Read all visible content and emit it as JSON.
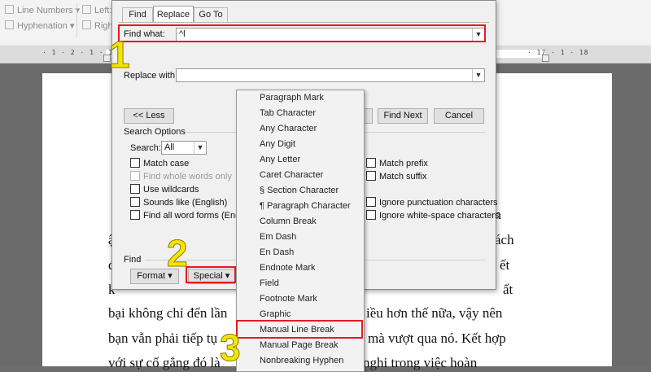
{
  "ribbon": {
    "line_numbers": "Line Numbers",
    "hyphenation": "Hyphenation",
    "left_label": "Left:",
    "right_label": "Righ"
  },
  "ruler": {
    "left_marks": "· 1 · 2 · 1 · 1 · 1 · 2",
    "right_marks": "· 17 · 1 · 18"
  },
  "document": {
    "lines_right": [
      "n",
      "h",
      "ăn",
      "ách",
      "ết",
      "ất"
    ],
    "line_left_1": "ậ",
    "line_left_2": "đ",
    "line_left_3": "k",
    "line_a_left": "bại không chỉ đến lần",
    "line_a_right": "iều hơn thế nữa, vậy nên",
    "line_b_left": "bạn vẫn phải tiếp tụ",
    "line_b_right": "mà vượt qua nó. Kết hợp",
    "line_c_left": "với sự cố gắng đó là",
    "line_c_right": "nghi trong việc hoàn"
  },
  "dialog": {
    "tabs": [
      "Find",
      "Replace",
      "Go To"
    ],
    "active_tab": "Replace",
    "find_what_label": "Find what:",
    "find_what_value": "^l",
    "replace_with_label": "Replace with:",
    "replace_with_value": "",
    "less_button": "<< Less",
    "find_next_button": "Find Next",
    "cancel_button": "Cancel",
    "search_options_title": "Search Options",
    "search_label": "Search:",
    "search_value": "All",
    "options_left": [
      {
        "label": "Match case",
        "checked": false,
        "enabled": true
      },
      {
        "label": "Find whole words only",
        "checked": false,
        "enabled": false
      },
      {
        "label": "Use wildcards",
        "checked": false,
        "enabled": true
      },
      {
        "label": "Sounds like (English)",
        "checked": false,
        "enabled": true
      },
      {
        "label": "Find all word forms (English",
        "checked": false,
        "enabled": true
      }
    ],
    "options_right": [
      {
        "label": "Match prefix",
        "checked": false
      },
      {
        "label": "Match suffix",
        "checked": false
      },
      {
        "label": "Ignore punctuation characters",
        "checked": false
      },
      {
        "label": "Ignore white-space characters",
        "checked": false
      }
    ],
    "find_section_title": "Find",
    "format_button": "Format",
    "special_button": "Special"
  },
  "special_menu": {
    "items": [
      "Paragraph Mark",
      "Tab Character",
      "Any Character",
      "Any Digit",
      "Any Letter",
      "Caret Character",
      "§ Section Character",
      "¶ Paragraph Character",
      "Column Break",
      "Em Dash",
      "En Dash",
      "Endnote Mark",
      "Field",
      "Footnote Mark",
      "Graphic",
      "Manual Line Break",
      "Manual Page Break",
      "Nonbreaking Hyphen"
    ],
    "highlighted": "Manual Line Break"
  },
  "steps": [
    "1",
    "2",
    "3"
  ],
  "colors": {
    "highlight": "#e31b23",
    "step_number": "#f5e400"
  }
}
